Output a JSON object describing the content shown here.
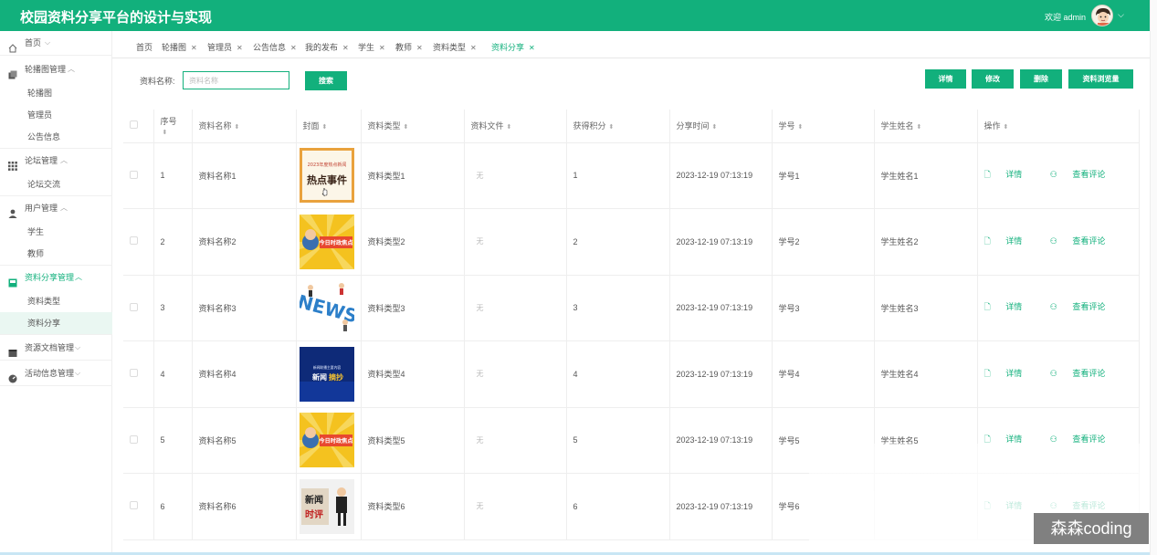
{
  "header": {
    "title": "校园资料分享平台的设计与实现",
    "welcome": "欢迎 admin",
    "avatar_icon": "cartoon-avatar-icon",
    "accent_color": "#12b07c"
  },
  "sidebar": {
    "home": "首页",
    "groups": [
      {
        "label": "轮播图管理",
        "icon": "image-stack-icon",
        "items": [
          "轮播图",
          "管理员",
          "公告信息"
        ]
      },
      {
        "label": "论坛管理",
        "icon": "grid-icon",
        "items": [
          "论坛交流"
        ]
      },
      {
        "label": "用户管理",
        "icon": "user-icon",
        "items": [
          "学生",
          "教师"
        ]
      },
      {
        "label": "资料分享管理",
        "icon": "inbox-icon",
        "items": [
          "资料类型",
          "资料分享"
        ]
      },
      {
        "label": "资源文档管理",
        "icon": "document-icon",
        "items": []
      },
      {
        "label": "活动信息管理",
        "icon": "gauge-icon",
        "items": []
      }
    ]
  },
  "tabs": [
    "首页",
    "轮播图",
    "管理员",
    "公告信息",
    "我的发布",
    "学生",
    "教师",
    "资料类型",
    "资料分享"
  ],
  "filter": {
    "label": "资料名称:",
    "placeholder": "资料名称",
    "search_button": "搜索"
  },
  "actions": [
    "详情",
    "修改",
    "删除",
    "资料浏览量"
  ],
  "table": {
    "columns": [
      "序号",
      "资料名称",
      "封面",
      "资料类型",
      "资料文件",
      "获得积分",
      "分享时间",
      "学号",
      "学生姓名",
      "操作"
    ],
    "rows": [
      {
        "no": "1",
        "name": "资料名称1",
        "cover": "hot-news-cover",
        "type": "资料类型1",
        "file": "无",
        "points": "1",
        "time": "2023-12-19 07:13:19",
        "sid": "学号1",
        "student": "学生姓名1"
      },
      {
        "no": "2",
        "name": "资料名称2",
        "cover": "today-focus-cover",
        "type": "资料类型2",
        "file": "无",
        "points": "2",
        "time": "2023-12-19 07:13:19",
        "sid": "学号2",
        "student": "学生姓名2"
      },
      {
        "no": "3",
        "name": "资料名称3",
        "cover": "news-3d-cover",
        "type": "资料类型3",
        "file": "无",
        "points": "3",
        "time": "2023-12-19 07:13:19",
        "sid": "学号3",
        "student": "学生姓名3"
      },
      {
        "no": "4",
        "name": "资料名称4",
        "cover": "news-summary-cover",
        "type": "资料类型4",
        "file": "无",
        "points": "4",
        "time": "2023-12-19 07:13:19",
        "sid": "学号4",
        "student": "学生姓名4"
      },
      {
        "no": "5",
        "name": "资料名称5",
        "cover": "today-focus-cover",
        "type": "资料类型5",
        "file": "无",
        "points": "5",
        "time": "2023-12-19 07:13:19",
        "sid": "学号5",
        "student": "学生姓名5"
      },
      {
        "no": "6",
        "name": "资料名称6",
        "cover": "news-commentary-cover",
        "type": "资料类型6",
        "file": "无",
        "points": "6",
        "time": "2023-12-19 07:13:19",
        "sid": "学号6",
        "student": ""
      }
    ],
    "row_actions": [
      "详情",
      "查看评论"
    ],
    "cover_texts": {
      "hot_top": "2023年度热点新闻",
      "hot": "热点事件",
      "today": "今日时政焦点",
      "news": "NEWS",
      "summary_top": "新闻联播主要内容",
      "summary_a": "新闻",
      "summary_b": "摘抄",
      "commentary_a": "新闻",
      "commentary_b": "时评"
    }
  },
  "watermark": "森森coding"
}
